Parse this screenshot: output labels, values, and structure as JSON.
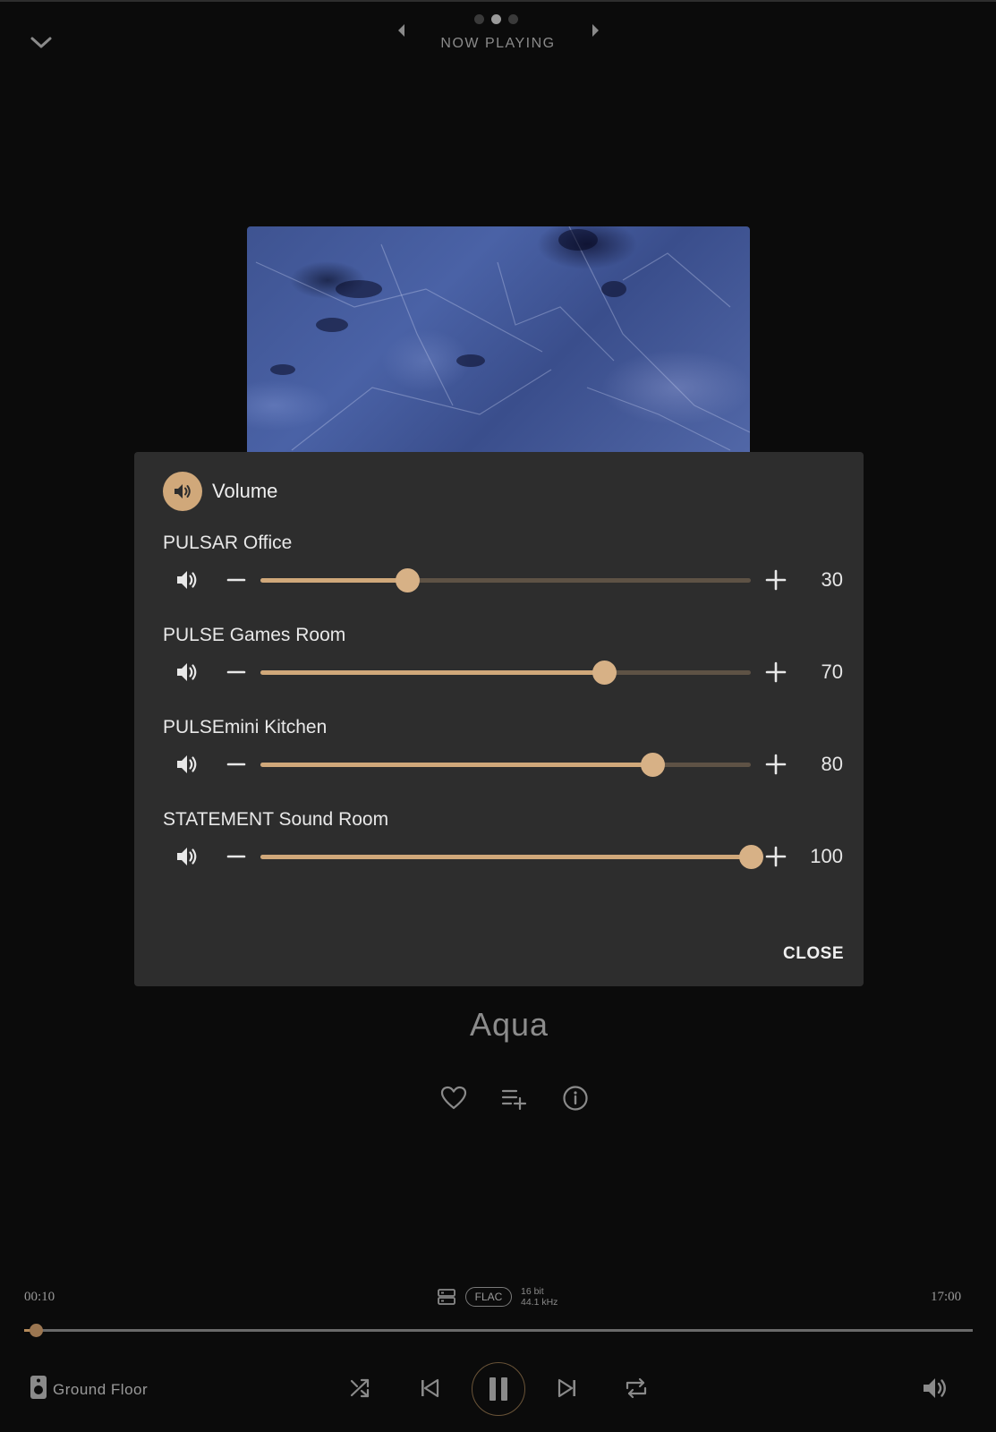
{
  "header": {
    "title": "NOW PLAYING",
    "pages": 3,
    "active_page": 1
  },
  "track": {
    "title": "Aqua",
    "current_time": "00:10",
    "duration": "17:00",
    "progress_fraction": 0.01,
    "format": "FLAC",
    "bit_depth": "16 bit",
    "sample_rate": "44.1 kHz"
  },
  "volume_dialog": {
    "title": "Volume",
    "close_label": "CLOSE",
    "zones": [
      {
        "name": "PULSAR Office",
        "value": 30
      },
      {
        "name": "PULSE Games Room",
        "value": 70
      },
      {
        "name": "PULSEmini Kitchen",
        "value": 80
      },
      {
        "name": "STATEMENT Sound Room",
        "value": 100
      }
    ]
  },
  "player": {
    "room": "Ground Floor",
    "icons": [
      "shuffle-icon",
      "previous-icon",
      "pause-icon",
      "next-icon",
      "repeat-icon",
      "volume-icon"
    ]
  },
  "colors": {
    "accent": "#d0a87a",
    "background": "#0b0b0b",
    "dialog": "#2d2d2d"
  }
}
